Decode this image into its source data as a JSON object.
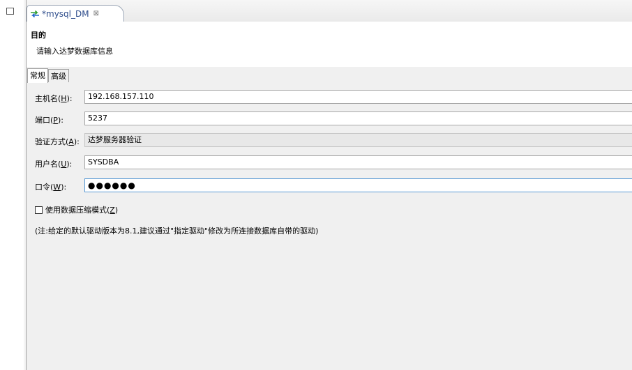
{
  "left_panel": {
    "restore_icon": "restore-icon"
  },
  "tab": {
    "title": "*mysql_DM",
    "close_glyph": "⊠",
    "icon": "db-transfer-icon"
  },
  "header": {
    "title": "目的",
    "description": "请输入达梦数据库信息"
  },
  "subtabs": [
    {
      "label": "常规",
      "active": true
    },
    {
      "label": "高级",
      "active": false
    }
  ],
  "form": {
    "host": {
      "label": "主机名(",
      "mnemonic": "H",
      "label_end": "):",
      "value": "192.168.157.110"
    },
    "port": {
      "label": "端口(",
      "mnemonic": "P",
      "label_end": "):",
      "value": "5237"
    },
    "auth": {
      "label": "验证方式(",
      "mnemonic": "A",
      "label_end": "):",
      "value": "达梦服务器验证"
    },
    "user": {
      "label": "用户名(",
      "mnemonic": "U",
      "label_end": "):",
      "value": "SYSDBA"
    },
    "password": {
      "label": "口令(",
      "mnemonic": "W",
      "label_end": "):",
      "value": "●●●●●●"
    },
    "compress": {
      "label": "使用数据压缩模式(",
      "mnemonic": "Z",
      "label_end": ")",
      "checked": false
    },
    "note": "(注:给定的默认驱动版本为8.1,建议通过\"指定驱动\"修改为所连接数据库自带的驱动)"
  }
}
